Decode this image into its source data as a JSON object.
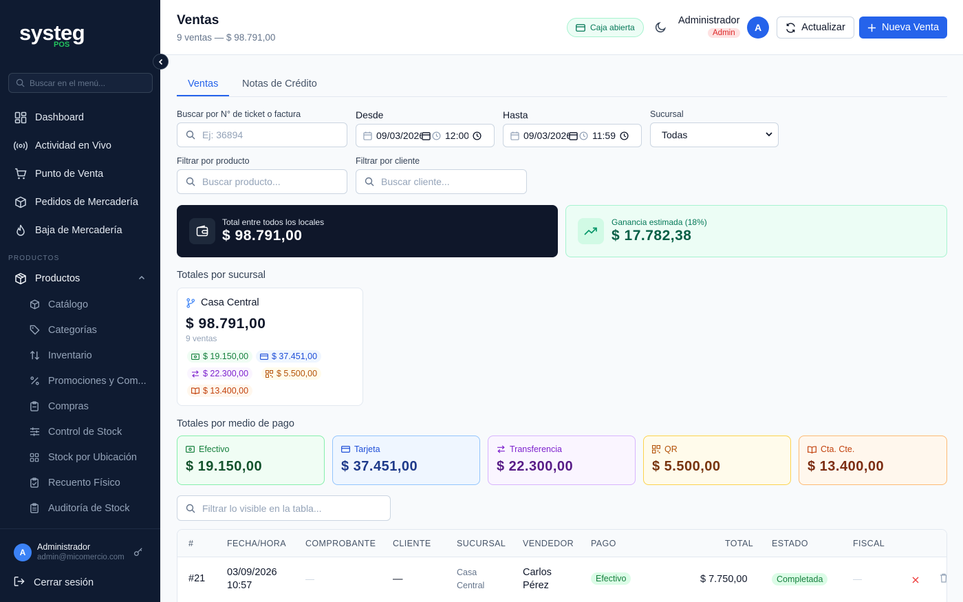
{
  "sidebar": {
    "logo": "systeg",
    "logo_sub": "POS",
    "search_placeholder": "Buscar en el menú...",
    "nav": [
      {
        "label": "Dashboard",
        "icon": "dashboard-icon"
      },
      {
        "label": "Actividad en Vivo",
        "icon": "broadcast-icon"
      },
      {
        "label": "Punto de Venta",
        "icon": "cart-icon"
      },
      {
        "label": "Pedidos de Mercadería",
        "icon": "box-icon"
      },
      {
        "label": "Baja de Mercadería",
        "icon": "flame-icon"
      }
    ],
    "section_label": "PRODUCTOS",
    "products_label": "Productos",
    "sub_items": [
      {
        "label": "Catálogo",
        "icon": "package-icon"
      },
      {
        "label": "Categorías",
        "icon": "tag-icon"
      },
      {
        "label": "Inventario",
        "icon": "arrows-updown-icon"
      },
      {
        "label": "Promociones y Com...",
        "icon": "percent-icon"
      },
      {
        "label": "Compras",
        "icon": "clipboard-icon"
      },
      {
        "label": "Control de Stock",
        "icon": "sliders-icon"
      },
      {
        "label": "Stock por Ubicación",
        "icon": "grid-icon"
      },
      {
        "label": "Recuento Físico",
        "icon": "clipboard-check-icon"
      },
      {
        "label": "Auditoría de Stock",
        "icon": "clipboard-list-icon"
      }
    ],
    "user": {
      "initial": "A",
      "name": "Administrador",
      "email": "admin@micomercio.com"
    },
    "logout": "Cerrar sesión"
  },
  "header": {
    "title": "Ventas",
    "subtitle": "9 ventas — $ 98.791,00",
    "caja_status": "Caja abierta",
    "admin_name": "Administrador",
    "admin_role": "Admin",
    "admin_initial": "A",
    "refresh_label": "Actualizar",
    "new_sale_label": "Nueva Venta"
  },
  "tabs": [
    "Ventas",
    "Notas de Crédito"
  ],
  "filters": {
    "ticket_label": "Buscar por N° de ticket o factura",
    "ticket_placeholder": "Ej: 36894",
    "desde_label": "Desde",
    "desde_date": "09/03/2026",
    "desde_time": "12:00",
    "hasta_label": "Hasta",
    "hasta_date": "09/03/2026",
    "hasta_time": "11:59",
    "sucursal_label": "Sucursal",
    "sucursal_value": "Todas",
    "product_label": "Filtrar por producto",
    "product_placeholder": "Buscar producto...",
    "client_label": "Filtrar por cliente",
    "client_placeholder": "Buscar cliente..."
  },
  "summary": {
    "total_label": "Total entre todos los locales",
    "total_amount": "$ 98.791,00",
    "gain_label": "Ganancia estimada (18%)",
    "gain_amount": "$ 17.782,38"
  },
  "branches_title": "Totales por sucursal",
  "branch": {
    "name": "Casa Central",
    "amount": "$ 98.791,00",
    "count": "9 ventas",
    "chips": [
      "$ 19.150,00",
      "$ 37.451,00",
      "$ 22.300,00",
      "$ 5.500,00",
      "$ 13.400,00"
    ]
  },
  "payments_title": "Totales por medio de pago",
  "payments": [
    {
      "label": "Efectivo",
      "amount": "$ 19.150,00",
      "icon": "cash-icon",
      "color": "#15803d"
    },
    {
      "label": "Tarjeta",
      "amount": "$ 37.451,00",
      "icon": "card-icon",
      "color": "#1d4ed8"
    },
    {
      "label": "Transferencia",
      "amount": "$ 22.300,00",
      "icon": "transfer-icon",
      "color": "#7e22ce"
    },
    {
      "label": "QR",
      "amount": "$ 5.500,00",
      "icon": "qr-icon",
      "color": "#b45309"
    },
    {
      "label": "Cta. Cte.",
      "amount": "$ 13.400,00",
      "icon": "book-icon",
      "color": "#c2410c"
    }
  ],
  "table_filter_placeholder": "Filtrar lo visible en la tabla...",
  "table": {
    "columns": [
      "#",
      "FECHA/HORA",
      "COMPROBANTE",
      "CLIENTE",
      "SUCURSAL",
      "VENDEDOR",
      "PAGO",
      "TOTAL",
      "ESTADO",
      "FISCAL"
    ],
    "rows": [
      {
        "num": "#21",
        "date": "03/09/2026",
        "time": "10:57",
        "comprobante": "—",
        "cliente": "—",
        "sucursal_1": "Casa",
        "sucursal_2": "Central",
        "vendedor_1": "Carlos",
        "vendedor_2": "Pérez",
        "pago": "Efectivo",
        "total": "$ 7.750,00",
        "estado": "Completada",
        "fiscal": "—"
      }
    ]
  }
}
